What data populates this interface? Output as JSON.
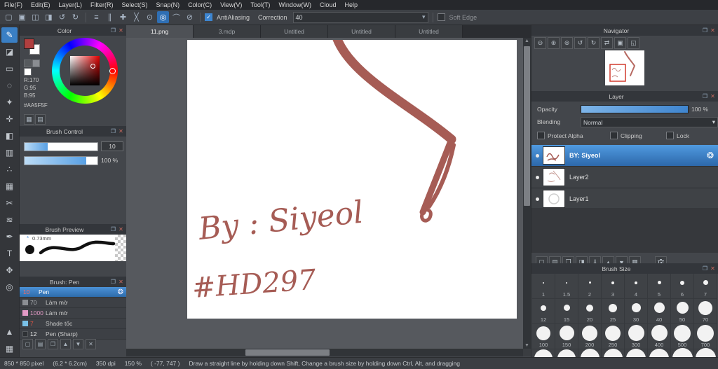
{
  "menu": {
    "items": [
      "File(F)",
      "Edit(E)",
      "Layer(L)",
      "Filter(R)",
      "Select(S)",
      "Snap(N)",
      "Color(C)",
      "View(V)",
      "Tool(T)",
      "Window(W)",
      "Cloud",
      "Help"
    ]
  },
  "toolbar": {
    "file_icons": [
      {
        "name": "new-file-icon",
        "glyph": "▢"
      },
      {
        "name": "open-file-icon",
        "glyph": "▣"
      },
      {
        "name": "save-icon",
        "glyph": "◫"
      },
      {
        "name": "export-icon",
        "glyph": "◨"
      },
      {
        "name": "undo-icon",
        "glyph": "↺"
      },
      {
        "name": "redo-icon",
        "glyph": "↻"
      }
    ],
    "snap_icons": [
      {
        "name": "snap-off-icon",
        "glyph": "≡"
      },
      {
        "name": "snap-parallel-icon",
        "glyph": "∥"
      },
      {
        "name": "snap-cross-icon",
        "glyph": "✚"
      },
      {
        "name": "snap-x-icon",
        "glyph": "╳"
      },
      {
        "name": "snap-vanishing-icon",
        "glyph": "⊙"
      },
      {
        "name": "snap-circle-icon",
        "glyph": "◎"
      },
      {
        "name": "snap-curve-icon",
        "glyph": "⌒"
      },
      {
        "name": "snap-settings-icon",
        "glyph": "⊘"
      }
    ],
    "antialiasing_label": "AntiAliasing",
    "correction_label": "Correction",
    "correction_value": "40",
    "soft_edge_label": "Soft Edge"
  },
  "tools": [
    {
      "name": "pen-tool",
      "glyph": "✎"
    },
    {
      "name": "eraser-tool",
      "glyph": "◪"
    },
    {
      "name": "select-rect-tool",
      "glyph": "▭"
    },
    {
      "name": "lasso-tool",
      "glyph": "◌"
    },
    {
      "name": "magic-wand-tool",
      "glyph": "✦"
    },
    {
      "name": "move-tool",
      "glyph": "✛"
    },
    {
      "name": "bucket-tool",
      "glyph": "◧"
    },
    {
      "name": "gradient-tool",
      "glyph": "▥"
    },
    {
      "name": "dot-tool",
      "glyph": "∴"
    },
    {
      "name": "pattern-tool",
      "glyph": "▦"
    },
    {
      "name": "scissors-tool",
      "glyph": "✂"
    },
    {
      "name": "blur-tool",
      "glyph": "≋"
    },
    {
      "name": "eyedropper-tool",
      "glyph": "✒"
    },
    {
      "name": "text-tool",
      "glyph": "T"
    },
    {
      "name": "hand-tool",
      "glyph": "✥"
    },
    {
      "name": "zoom-tool",
      "glyph": "◎"
    },
    {
      "name": "panel-up-icon",
      "glyph": "▲"
    },
    {
      "name": "panel-grid-icon",
      "glyph": "▦"
    }
  ],
  "panel_icons": {
    "popout": "❐",
    "close": "✕"
  },
  "color_panel": {
    "title": "Color",
    "r_label": "R:170",
    "g_label": "G:95",
    "b_label": "B:95",
    "hex": "#AA5F5F",
    "swatch_icons": [
      {
        "name": "palette-icon",
        "glyph": "▦"
      },
      {
        "name": "slider-view-icon",
        "glyph": "▤"
      }
    ]
  },
  "brush_control": {
    "title": "Brush Control",
    "size_value": "10",
    "opacity_value": "100 %"
  },
  "brush_preview": {
    "title": "Brush Preview",
    "width_label": "0.73mm"
  },
  "brush_panel": {
    "title": "Brush:  Pen",
    "gear_icon": "❂",
    "items": [
      {
        "size": "10",
        "name": "Pen"
      },
      {
        "size": "70",
        "name": "Làm mờ"
      },
      {
        "size": "1000",
        "name": "Làm mờ"
      },
      {
        "size": "7",
        "name": "Shade tốc"
      },
      {
        "size": "12",
        "name": "Pen (Sharp)"
      }
    ],
    "footer_icons": [
      {
        "name": "add-brush-icon",
        "glyph": "▢"
      },
      {
        "name": "brush-folder-icon",
        "glyph": "▤"
      },
      {
        "name": "duplicate-brush-icon",
        "glyph": "❐"
      },
      {
        "name": "brush-up-icon",
        "glyph": "▲"
      },
      {
        "name": "brush-down-icon",
        "glyph": "▼"
      },
      {
        "name": "delete-brush-icon",
        "glyph": "✕"
      }
    ]
  },
  "tabs": [
    "11.png",
    "3.mdp",
    "Untitled",
    "Untitled",
    "Untitled"
  ],
  "canvas": {
    "signature": "By : Siyeol",
    "code": "#HD297",
    "stroke_color": "#a65c55"
  },
  "navigator": {
    "title": "Navigator",
    "icons": [
      {
        "name": "zoom-out-icon",
        "glyph": "⊖"
      },
      {
        "name": "zoom-in-icon",
        "glyph": "⊕"
      },
      {
        "name": "zoom-reset-icon",
        "glyph": "⊚"
      },
      {
        "name": "rotate-ccw-icon",
        "glyph": "↺"
      },
      {
        "name": "rotate-cw-icon",
        "glyph": "↻"
      },
      {
        "name": "flip-icon",
        "glyph": "⇄"
      },
      {
        "name": "fit-window-icon",
        "glyph": "▣"
      },
      {
        "name": "fit-width-icon",
        "glyph": "◱"
      }
    ]
  },
  "layer_panel": {
    "title": "Layer",
    "opacity_label": "Opacity",
    "opacity_value": "100 %",
    "blending_label": "Blending",
    "blending_value": "Normal",
    "protect_alpha_label": "Protect Alpha",
    "clipping_label": "Clipping",
    "lock_label": "Lock",
    "gear_icon": "❂",
    "layers": [
      {
        "name": "BY: Siyeol"
      },
      {
        "name": "Layer2"
      },
      {
        "name": "Layer1"
      }
    ],
    "footer_icons": [
      {
        "name": "new-layer-icon",
        "glyph": "▢"
      },
      {
        "name": "new-folder-icon",
        "glyph": "▤"
      },
      {
        "name": "duplicate-layer-icon",
        "glyph": "❐"
      },
      {
        "name": "transfer-layer-icon",
        "glyph": "◨"
      },
      {
        "name": "merge-down-icon",
        "glyph": "⇓"
      },
      {
        "name": "layer-up-icon",
        "glyph": "▲"
      },
      {
        "name": "layer-down-icon",
        "glyph": "▼"
      },
      {
        "name": "layer-grid-icon",
        "glyph": "▦"
      }
    ]
  },
  "brush_size": {
    "title": "Brush Size",
    "sizes": [
      "1",
      "1.5",
      "2",
      "3",
      "4",
      "5",
      "6",
      "7",
      "12",
      "15",
      "20",
      "25",
      "30",
      "40",
      "50",
      "70",
      "100",
      "150",
      "200",
      "250",
      "300",
      "400",
      "500",
      "700"
    ]
  },
  "status": {
    "pixel": "850 * 850 pixel",
    "cm": "(6.2 * 6.2cm)",
    "dpi": "350 dpi",
    "zoom": "150 %",
    "coords": "( -77, 747 )",
    "hint": "Draw a straight line by holding down Shift, Change a brush size by holding down Ctrl, Alt, and dragging"
  }
}
